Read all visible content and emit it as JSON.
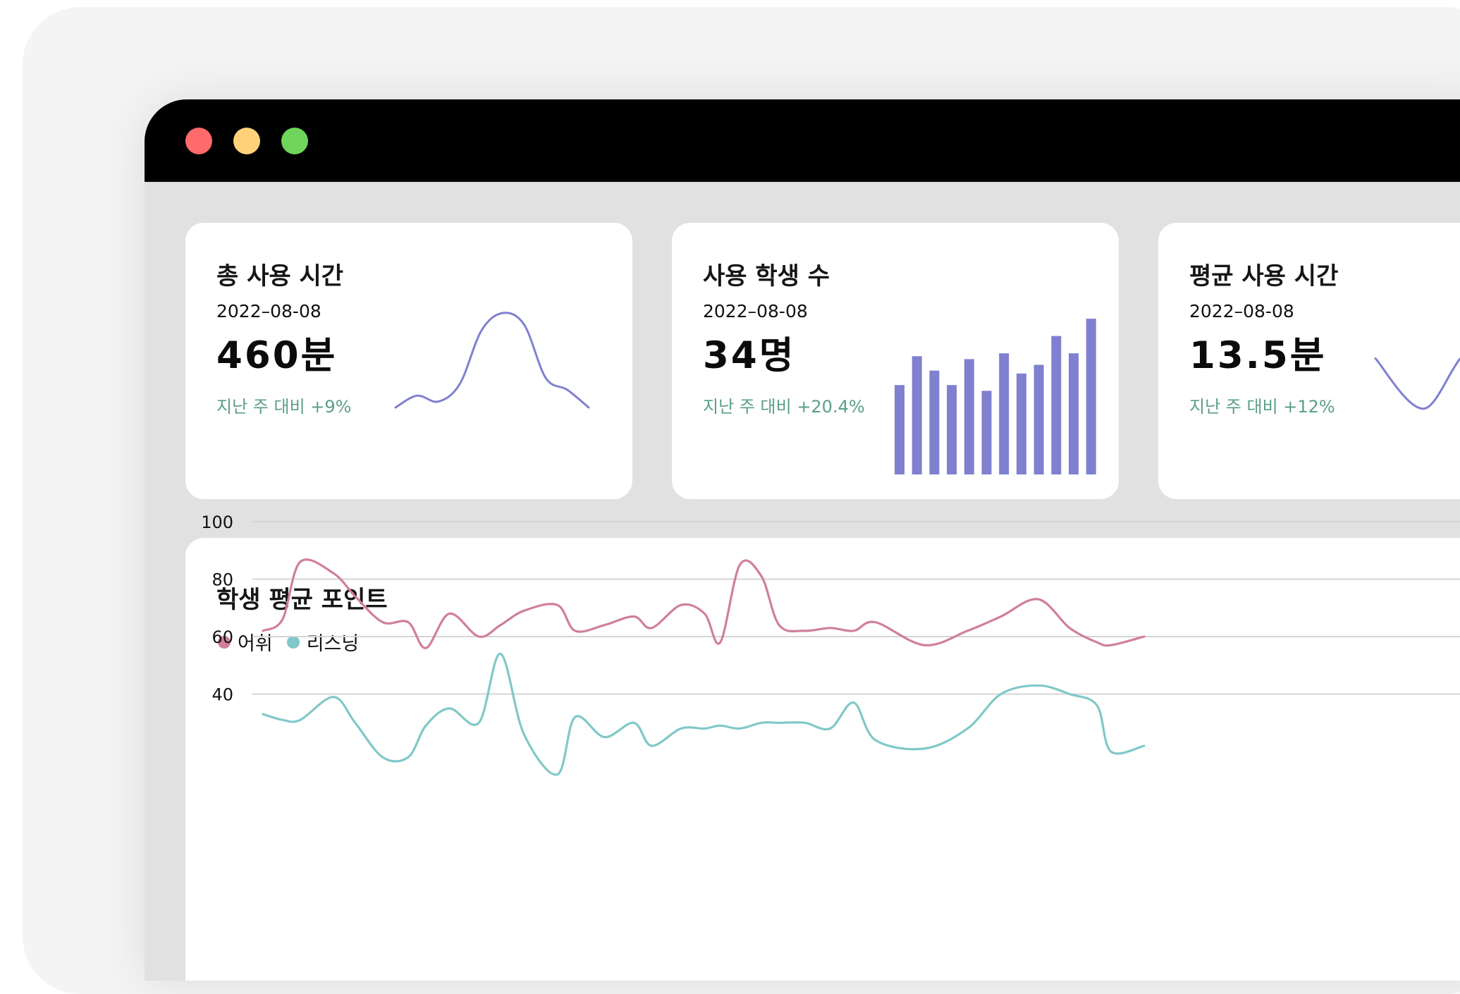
{
  "window": {
    "controls": [
      {
        "name": "close",
        "color": "#ff6b6b"
      },
      {
        "name": "minimize",
        "color": "#ffd27a"
      },
      {
        "name": "maximize",
        "color": "#6fd45c"
      }
    ]
  },
  "colors": {
    "accent": "#8080d0",
    "positive": "#5b9f84",
    "vocab": "#d07f9b",
    "listening": "#80c8c8"
  },
  "stats": [
    {
      "title": "총 사용 시간",
      "date": "2022–08-08",
      "value": "460분",
      "change": "지난 주 대비 +9%",
      "spark_type": "line"
    },
    {
      "title": "사용 학생 수",
      "date": "2022–08-08",
      "value": "34명",
      "change": "지난 주 대비 +20.4%",
      "spark_type": "bar"
    },
    {
      "title": "평균 사용 시간",
      "date": "2022–08-08",
      "value": "13.5분",
      "change": "지난 주 대비 +12%",
      "spark_type": "line"
    }
  ],
  "chart": {
    "title": "학생 평균 포인트",
    "legend": [
      {
        "label": "어휘",
        "color": "#d07f9b"
      },
      {
        "label": "리스닝",
        "color": "#80c8c8"
      }
    ]
  },
  "chart_data": [
    {
      "type": "line",
      "title": "",
      "series": [
        {
          "values": [
            60,
            62,
            61,
            64,
            73,
            76,
            74,
            65,
            63,
            60
          ]
        }
      ]
    },
    {
      "type": "bar",
      "title": "",
      "values": [
        31,
        41,
        36,
        31,
        40,
        29,
        42,
        35,
        38,
        48,
        42,
        54
      ],
      "ylim": [
        0,
        55
      ]
    },
    {
      "type": "line",
      "title": "",
      "series": [
        {
          "values": [
            70,
            55,
            72,
            48,
            62
          ]
        }
      ]
    },
    {
      "type": "line",
      "title": "",
      "ylabel": "",
      "yticks": [
        100,
        80,
        60,
        40
      ],
      "ylim": [
        0,
        100
      ],
      "grid": true,
      "legend": "top-left",
      "x": [
        0,
        10,
        19,
        36,
        47,
        61,
        74,
        83,
        95,
        110,
        121,
        133,
        150,
        159,
        174,
        189,
        198,
        213,
        225,
        233,
        243,
        254,
        263,
        276,
        289,
        301,
        312,
        337,
        359,
        376,
        395,
        411,
        425,
        432,
        449
      ],
      "series": [
        {
          "name": "어휘",
          "color": "#d07f9b",
          "values": [
            62,
            66,
            86,
            82,
            74,
            65,
            65,
            56,
            68,
            60,
            64,
            69,
            71,
            62,
            64,
            67,
            63,
            71,
            68,
            58,
            85,
            81,
            64,
            62,
            63,
            62,
            65,
            57,
            62,
            67,
            73,
            63,
            58,
            57,
            60
          ]
        },
        {
          "name": "리스닝",
          "color": "#80c8c8",
          "values": [
            33,
            31,
            31,
            39,
            30,
            18,
            18,
            29,
            35,
            30,
            54,
            26,
            12,
            32,
            25,
            30,
            22,
            28,
            28,
            29,
            28,
            30,
            30,
            30,
            28,
            37,
            24,
            21,
            28,
            40,
            43,
            40,
            36,
            20,
            22
          ]
        }
      ]
    }
  ]
}
